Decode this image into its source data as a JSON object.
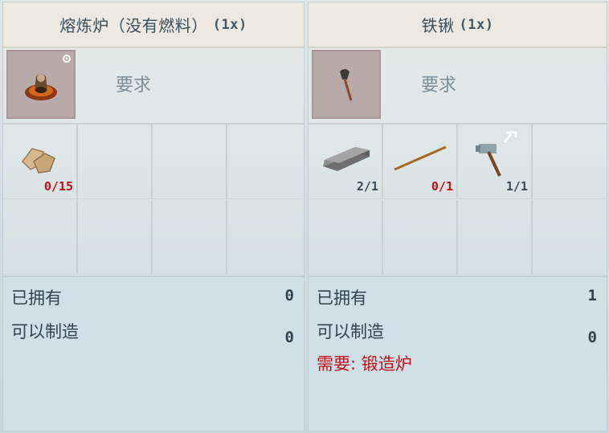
{
  "panels": [
    {
      "title": "熔炼炉（没有燃料）",
      "quantity": "(1x)",
      "requirements_label": "要求",
      "result_icon": "furnace-icon",
      "ingredients": [
        {
          "icon": "stone-icon",
          "count": "0/15",
          "status": "insufficient"
        },
        null,
        null,
        null,
        null,
        null,
        null,
        null
      ],
      "owned_label": "已拥有",
      "owned_value": "0",
      "craftable_label": "可以制造",
      "craftable_value": "0"
    },
    {
      "title": "铁锹",
      "quantity": "(1x)",
      "requirements_label": "要求",
      "result_icon": "shovel-icon",
      "ingredients": [
        {
          "icon": "iron-ingot-icon",
          "count": "2/1",
          "status": "ok"
        },
        {
          "icon": "stick-icon",
          "count": "0/1",
          "status": "insufficient"
        },
        {
          "icon": "hammer-icon",
          "count": "1/1",
          "status": "ok"
        },
        null,
        null,
        null,
        null,
        null
      ],
      "owned_label": "已拥有",
      "owned_value": "1",
      "craftable_label": "可以制造",
      "craftable_value": "0",
      "requirement_note": "需要: 锻造炉"
    }
  ],
  "colors": {
    "insufficient": "#c0101a",
    "ok": "#374c58",
    "result_slot": "#b8a9ab"
  }
}
